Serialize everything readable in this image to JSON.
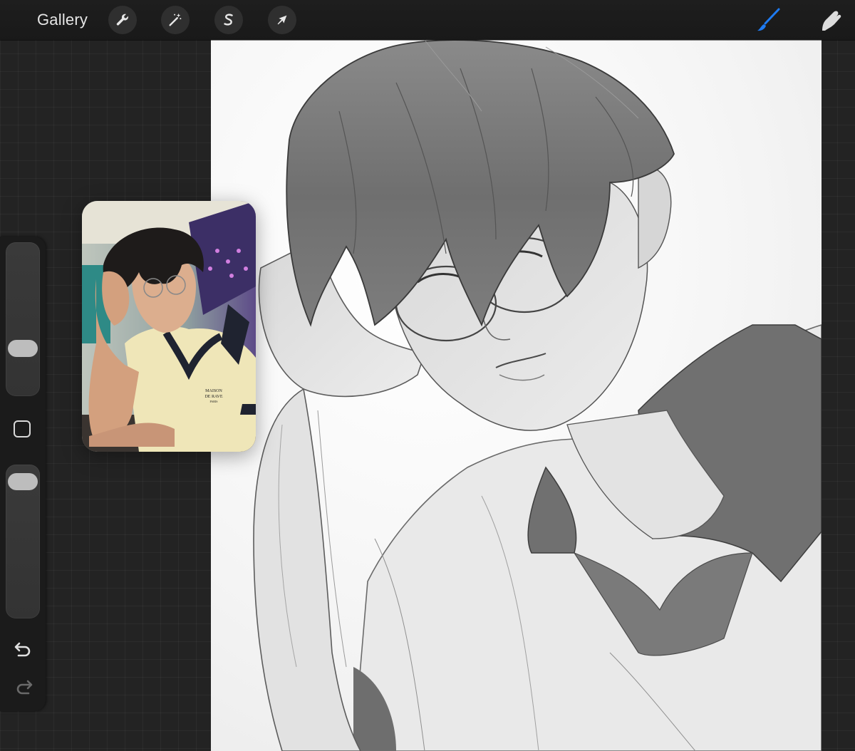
{
  "toolbar": {
    "gallery_label": "Gallery",
    "tools": [
      {
        "name": "actions",
        "icon": "wrench-icon"
      },
      {
        "name": "adjustments",
        "icon": "magic-wand-icon"
      },
      {
        "name": "selection",
        "icon": "selection-s-icon"
      },
      {
        "name": "transform",
        "icon": "arrow-cursor-icon"
      }
    ],
    "right_tools": [
      {
        "name": "brush",
        "icon": "brush-icon",
        "active": true
      },
      {
        "name": "smudge",
        "icon": "smudge-finger-icon",
        "active": false
      }
    ],
    "accent_color": "#1e7bf2"
  },
  "sidebar": {
    "brush_size_level": 0.72,
    "opacity_level": 0.05,
    "modify_button_icon": "square-icon",
    "undo_icon": "undo-icon",
    "redo_icon": "redo-icon"
  },
  "reference": {
    "print_line1": "MAISON",
    "print_line2": "DE RAVE",
    "print_line3": "PARIS"
  }
}
